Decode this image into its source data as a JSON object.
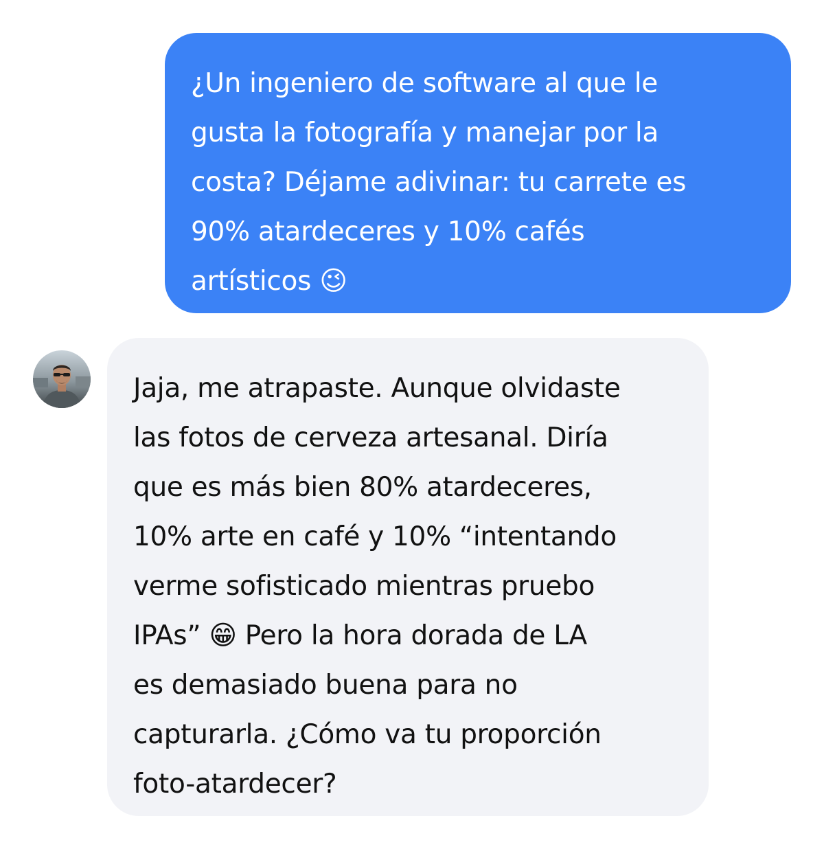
{
  "conversation": {
    "messages": [
      {
        "sender": "user",
        "text": "¿Un ingeniero de software al que le\ngusta la fotografía y manejar por la\ncosta? Déjame adivinar: tu carrete es\n90% atardeceres y 10% cafés\nartísticos 😉"
      },
      {
        "sender": "contact",
        "avatar_icon": "person-photo-avatar",
        "text": "Jaja, me atrapaste. Aunque olvidaste\nlas fotos de cerveza artesanal. Diría\nque es más bien 80% atardeceres,\n10% arte en café y 10% “intentando\nverme sofisticado mientras pruebo\nIPAs” 😁 Pero la hora dorada de LA\nes demasiado buena para no\ncapturarla. ¿Cómo va tu proporción\nfoto-atardecer?"
      }
    ]
  },
  "colors": {
    "outgoing_bubble": "#3b82f6",
    "incoming_bubble": "#f2f3f7",
    "outgoing_text": "#ffffff",
    "incoming_text": "#111111"
  }
}
